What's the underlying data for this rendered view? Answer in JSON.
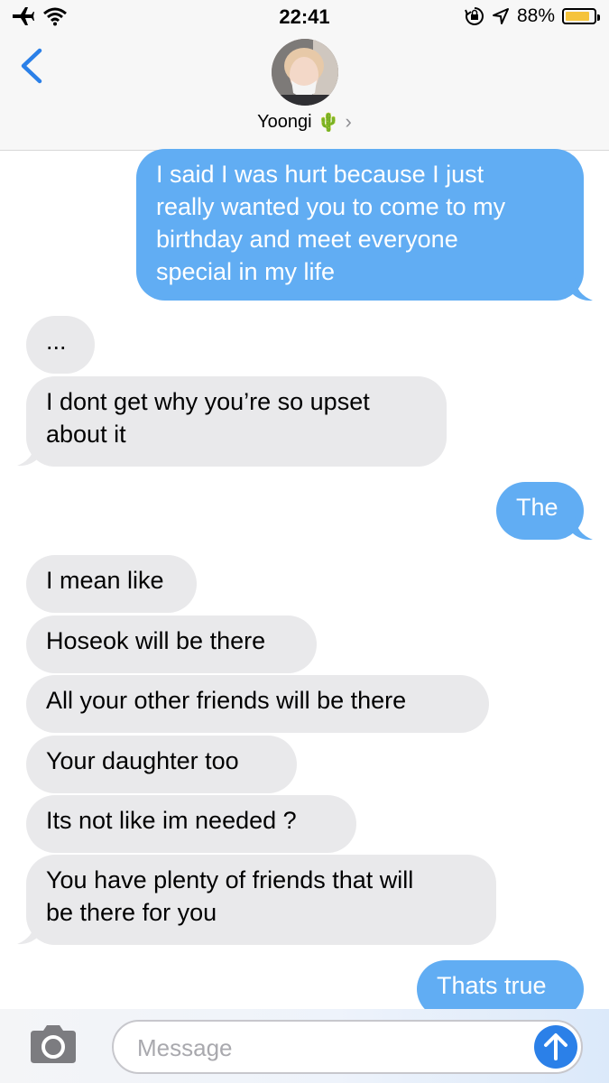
{
  "status_bar": {
    "time": "22:41",
    "battery_percent": "88%",
    "battery_level": 0.88,
    "icons": [
      "airplane-icon",
      "wifi-icon",
      "rotation-lock-icon",
      "location-arrow-icon",
      "battery-icon"
    ]
  },
  "header": {
    "contact_name": "Yoongi",
    "contact_emoji": "🌵",
    "back_icon": "chevron-left-icon",
    "detail_icon": "chevron-right-icon"
  },
  "messages": [
    {
      "direction": "sent",
      "text": "I said I was hurt because I just\nreally wanted you to come to my\nbirthday and meet everyone\nspecial in my life"
    },
    {
      "direction": "received",
      "text": "..."
    },
    {
      "direction": "received",
      "text": "I dont get why you’re so upset\nabout it"
    },
    {
      "direction": "sent",
      "text": "The"
    },
    {
      "direction": "received",
      "text": "I mean like"
    },
    {
      "direction": "received",
      "text": "Hoseok will be there"
    },
    {
      "direction": "received",
      "text": "All your other friends will be there"
    },
    {
      "direction": "received",
      "text": "Your daughter too"
    },
    {
      "direction": "received",
      "text": "Its not like im needed ?"
    },
    {
      "direction": "received",
      "text": "You have plenty of friends that will\nbe there for you"
    },
    {
      "direction": "sent",
      "text": "Thats true"
    }
  ],
  "composer": {
    "placeholder": "Message",
    "camera_icon": "camera-icon",
    "send_icon": "arrow-up-icon"
  },
  "colors": {
    "sent_bubble": "#61ADF3",
    "received_bubble": "#E9E9EB",
    "accent": "#2B80E8",
    "battery": "#F5C33B"
  }
}
